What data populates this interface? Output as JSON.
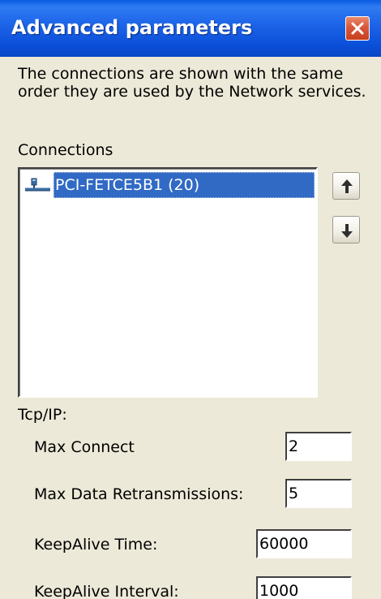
{
  "dialog": {
    "title": "Advanced parameters",
    "description": "The connections are shown with the same order they are used by the Network services."
  },
  "connections": {
    "label": "Connections",
    "items": [
      {
        "label": "PCI-FETCE5B1 (20)",
        "selected": true,
        "icon": "network-connection-icon"
      }
    ],
    "move_up_icon": "arrow-up-icon",
    "move_down_icon": "arrow-down-icon"
  },
  "tcpip": {
    "label": "Tcp/IP:",
    "max_connect": {
      "label": "Max Connect",
      "value": "2"
    },
    "max_data_retransmissions": {
      "label": "Max Data Retransmissions:",
      "value": "5"
    },
    "keepalive_time": {
      "label": "KeepAlive Time:",
      "value": "60000"
    },
    "keepalive_interval": {
      "label": "KeepAlive Interval:",
      "value": "1000"
    }
  },
  "colors": {
    "titlebar": "#0B4FD8",
    "dialog_background": "#ECE9D8",
    "selection": "#316AC5",
    "close_button": "#D9573A"
  }
}
